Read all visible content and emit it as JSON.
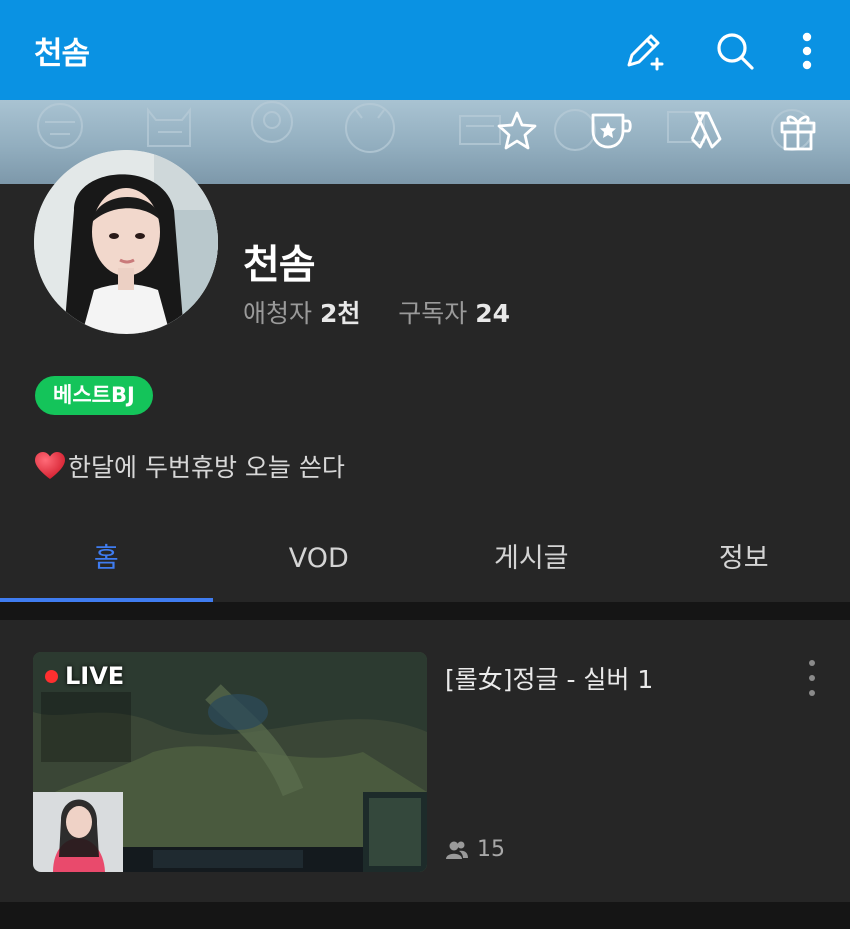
{
  "appbar": {
    "title": "천솜",
    "icons": [
      "edit-icon",
      "search-icon",
      "more-vertical-icon"
    ]
  },
  "banner": {
    "icons": [
      "star-icon",
      "badge-cup-icon",
      "ribbon-icon",
      "gift-icon"
    ]
  },
  "profile": {
    "name": "천솜",
    "fans_label": "애청자",
    "fans_value": "2천",
    "subs_label": "구독자",
    "subs_value": "24",
    "badge": "베스트BJ",
    "bio": "한달에 두번휴방 오늘 쓴다"
  },
  "tabs": [
    {
      "label": "홈",
      "active": true
    },
    {
      "label": "VOD",
      "active": false
    },
    {
      "label": "게시글",
      "active": false
    },
    {
      "label": "정보",
      "active": false
    }
  ],
  "live": {
    "tag": "LIVE",
    "title": "[롤女]정글 - 실버 1",
    "viewers": "15"
  },
  "colors": {
    "accent": "#0a92e3",
    "tab_active": "#3f7cf0",
    "badge": "#14c45a",
    "live_red": "#ff2f2f"
  }
}
